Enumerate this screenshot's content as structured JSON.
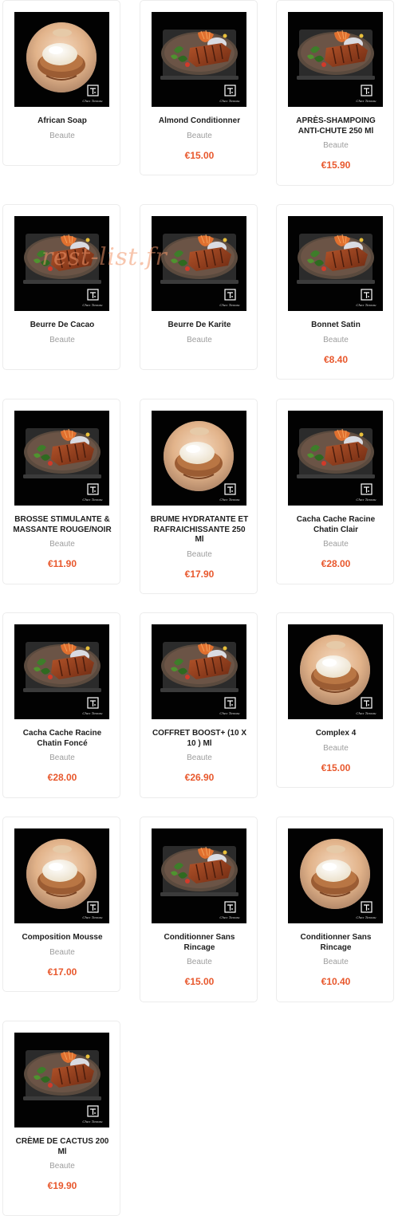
{
  "watermark": "rest-list.fr",
  "logo_caption": "Chez Tessou",
  "colors": {
    "price": "#e8582d",
    "category": "#9d9d9d",
    "title": "#1e1e1e"
  },
  "products": [
    {
      "title": "African Soap",
      "category": "Beaute",
      "price": "",
      "image": "cream-bowl"
    },
    {
      "title": "Almond Conditionner",
      "category": "Beaute",
      "price": "€15.00",
      "image": "steak-plate"
    },
    {
      "title": "APRÈS-SHAMPOING ANTI-CHUTE 250 Ml",
      "category": "Beaute",
      "price": "€15.90",
      "image": "steak-plate"
    },
    {
      "title": "Beurre De Cacao",
      "category": "Beaute",
      "price": "",
      "image": "steak-plate"
    },
    {
      "title": "Beurre De Karite",
      "category": "Beaute",
      "price": "",
      "image": "steak-plate"
    },
    {
      "title": "Bonnet Satin",
      "category": "Beaute",
      "price": "€8.40",
      "image": "steak-plate"
    },
    {
      "title": "BROSSE STIMULANTE & MASSANTE ROUGE/NOIR",
      "category": "Beaute",
      "price": "€11.90",
      "image": "steak-plate"
    },
    {
      "title": "BRUME HYDRATANTE ET RAFRAICHISSANTE 250 Ml",
      "category": "Beaute",
      "price": "€17.90",
      "image": "cream-bowl"
    },
    {
      "title": "Cacha Cache Racine Chatin Clair",
      "category": "Beaute",
      "price": "€28.00",
      "image": "steak-plate"
    },
    {
      "title": "Cacha Cache Racine Chatin Foncé",
      "category": "Beaute",
      "price": "€28.00",
      "image": "steak-plate"
    },
    {
      "title": "COFFRET BOOST+ (10 X 10 ) Ml",
      "category": "Beaute",
      "price": "€26.90",
      "image": "steak-plate"
    },
    {
      "title": "Complex 4",
      "category": "Beaute",
      "price": "€15.00",
      "image": "cream-bowl"
    },
    {
      "title": "Composition Mousse",
      "category": "Beaute",
      "price": "€17.00",
      "image": "cream-bowl"
    },
    {
      "title": "Conditionner Sans Rincage",
      "category": "Beaute",
      "price": "€15.00",
      "image": "steak-plate"
    },
    {
      "title": "Conditionner Sans Rincage",
      "category": "Beaute",
      "price": "€10.40",
      "image": "cream-bowl"
    },
    {
      "title": "CRÈME DE CACTUS 200 Ml",
      "category": "Beaute",
      "price": "€19.90",
      "image": "steak-plate"
    }
  ]
}
